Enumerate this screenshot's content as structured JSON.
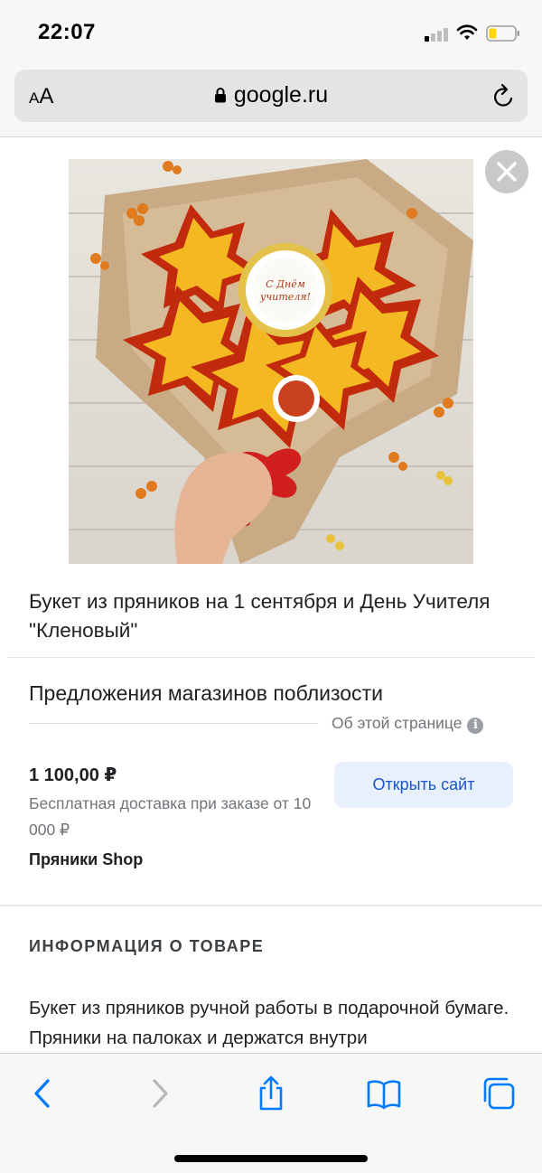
{
  "status_bar": {
    "time": "22:07"
  },
  "browser": {
    "text_size_label_small": "A",
    "text_size_label_large": "A",
    "url": "google.ru",
    "accent_color": "#007aff"
  },
  "product": {
    "image_description_icon": "product-photo",
    "title": "Букет из пряников на 1 сентября и День Учителя \"Кленовый\""
  },
  "offers": {
    "heading": "Предложения магазинов поблизости",
    "about_page": "Об этой странице",
    "items": [
      {
        "price": "1 100,00 ₽",
        "delivery": "Бесплатная доставка при заказе от 10 000 ₽",
        "shop": "Пряники Shop",
        "button": "Открыть сайт"
      }
    ]
  },
  "info": {
    "heading": "ИНФОРМАЦИЯ О ТОВАРЕ",
    "description": "Букет из пряников ручной работы в подарочной бумаге. Пряники на палоках и держатся внутри"
  },
  "toolbar": {
    "buttons": [
      "back-icon",
      "forward-icon",
      "share-icon",
      "bookmarks-icon",
      "tabs-icon"
    ]
  }
}
